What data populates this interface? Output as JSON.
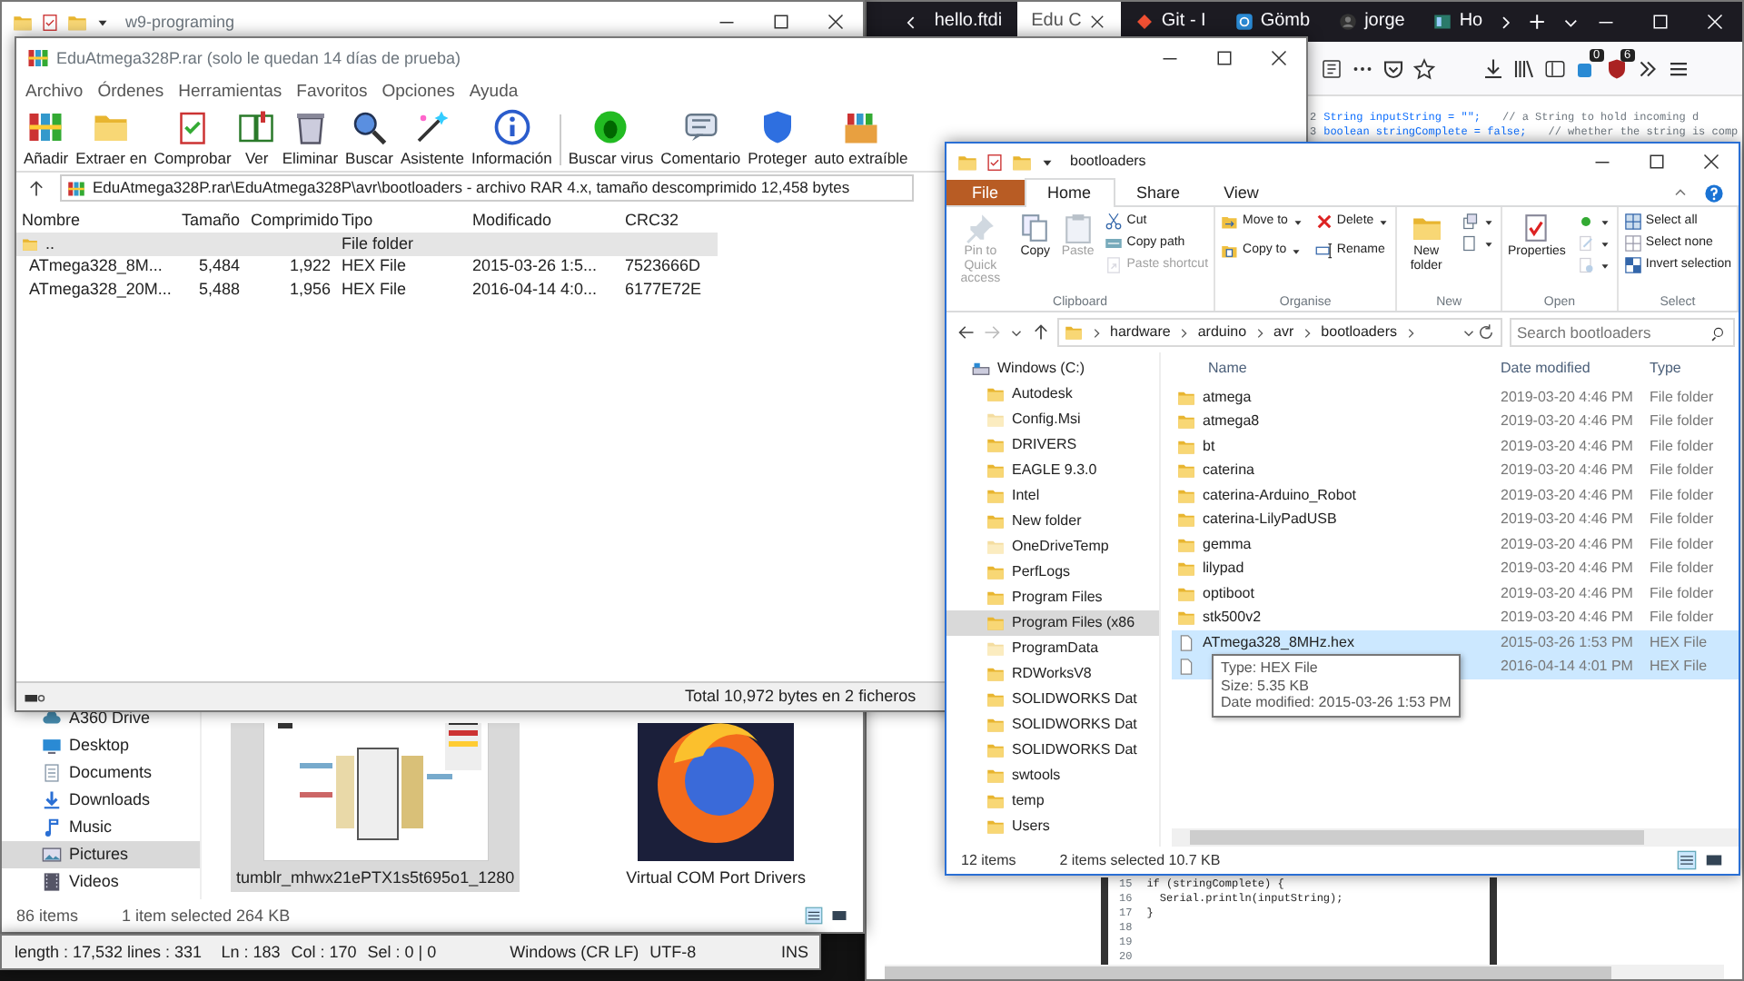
{
  "browser": {
    "tabs": [
      {
        "label": "hello.ftdi",
        "selected": false
      },
      {
        "label": "Edu C",
        "selected": true
      },
      {
        "label": "Git - I",
        "selected": false
      },
      {
        "label": "Gömb",
        "selected": false
      },
      {
        "label": "jorge",
        "selected": false
      },
      {
        "label": "Ho",
        "selected": false
      }
    ],
    "badges": [
      "0",
      "6"
    ],
    "code_top": [
      {
        "line": "2",
        "code": "String inputString = \"\";",
        "comment": "// a String to hold incoming d"
      },
      {
        "line": "3",
        "code": "boolean stringComplete = false;",
        "comment": "// whether the string is comp"
      }
    ],
    "code_bottom": [
      {
        "line": "15",
        "code": "if (stringComplete) {"
      },
      {
        "line": "16",
        "code": "  Serial.println(inputString);"
      },
      {
        "line": "17",
        "code": "}"
      },
      {
        "line": "18"
      },
      {
        "line": "19"
      },
      {
        "line": "20"
      }
    ]
  },
  "back_explorer": {
    "title": "w9-programing",
    "nav": [
      {
        "label": "A360 Drive",
        "selected": false
      },
      {
        "label": "Desktop",
        "selected": false
      },
      {
        "label": "Documents",
        "selected": false
      },
      {
        "label": "Downloads",
        "selected": false
      },
      {
        "label": "Music",
        "selected": false
      },
      {
        "label": "Pictures",
        "selected": true
      },
      {
        "label": "Videos",
        "selected": false
      }
    ],
    "thumbnails": [
      {
        "caption": "tumblr_mhwx21ePTX1s5t695o1_1280",
        "selected": true
      },
      {
        "caption": "Virtual COM Port Drivers",
        "selected": false
      }
    ],
    "status": {
      "count": "86 items",
      "selection": "1 item selected  264 KB"
    }
  },
  "editor_status": [
    "length : 17,532",
    "lines : 331",
    "Ln : 183",
    "Col : 170",
    "Sel : 0 | 0",
    "Windows (CR LF)",
    "UTF-8",
    "INS"
  ],
  "winrar": {
    "title": "EduAtmega328P.rar (solo le quedan 14 días de prueba)",
    "menu": [
      "Archivo",
      "Órdenes",
      "Herramientas",
      "Favoritos",
      "Opciones",
      "Ayuda"
    ],
    "toolbar": [
      "Añadir",
      "Extraer en",
      "Comprobar",
      "Ver",
      "Eliminar",
      "Buscar",
      "Asistente",
      "Información",
      "Buscar virus",
      "Comentario",
      "Proteger",
      "auto extraíble"
    ],
    "path": "EduAtmega328P.rar\\EduAtmega328P\\avr\\bootloaders - archivo RAR 4.x, tamaño descomprimido 12,458 bytes",
    "columns": [
      "Nombre",
      "Tamaño",
      "Comprimido",
      "Tipo",
      "Modificado",
      "CRC32"
    ],
    "rows": [
      {
        "kind": "folder",
        "name": "..",
        "type": "File folder",
        "selected": true
      },
      {
        "kind": "file",
        "name": "ATmega328_8M...",
        "size": "5,484",
        "packed": "1,922",
        "type": "HEX File",
        "modified": "2015-03-26 1:5...",
        "crc": "7523666D",
        "selected": false
      },
      {
        "kind": "file",
        "name": "ATmega328_20M...",
        "size": "5,488",
        "packed": "1,956",
        "type": "HEX File",
        "modified": "2016-04-14 4:0...",
        "crc": "6177E72E",
        "selected": false
      }
    ],
    "status": "Total 10,972 bytes en 2 ficheros"
  },
  "explorer": {
    "title": "bootloaders",
    "ribbon_tabs": [
      {
        "label": "File",
        "kind": "file",
        "selected": false
      },
      {
        "label": "Home",
        "kind": "tab",
        "selected": true
      },
      {
        "label": "Share",
        "kind": "tab",
        "selected": false
      },
      {
        "label": "View",
        "kind": "tab",
        "selected": false
      }
    ],
    "groups": [
      {
        "label": "Clipboard",
        "commands": [
          {
            "label": "Pin to Quick access",
            "kind": "large",
            "disabled": true
          },
          {
            "label": "Copy",
            "kind": "large",
            "disabled": false
          },
          {
            "label": "Paste",
            "kind": "large",
            "disabled": true
          },
          {
            "label": "Cut",
            "kind": "small",
            "disabled": false
          },
          {
            "label": "Copy path",
            "kind": "small",
            "disabled": false
          },
          {
            "label": "Paste shortcut",
            "kind": "small",
            "disabled": true
          }
        ]
      },
      {
        "label": "Organise",
        "commands": [
          {
            "label": "Move to",
            "kind": "split",
            "disabled": false
          },
          {
            "label": "Delete",
            "kind": "split",
            "disabled": false
          },
          {
            "label": "Copy to",
            "kind": "split",
            "disabled": false
          },
          {
            "label": "Rename",
            "kind": "small",
            "disabled": false
          }
        ]
      },
      {
        "label": "New",
        "commands": [
          {
            "label": "New folder",
            "kind": "large",
            "disabled": false
          },
          {
            "kind": "icon",
            "disabled": false
          },
          {
            "kind": "icon",
            "disabled": false
          }
        ]
      },
      {
        "label": "Open",
        "commands": [
          {
            "label": "Properties",
            "kind": "large",
            "disabled": false
          },
          {
            "kind": "icon",
            "disabled": false
          },
          {
            "kind": "icon",
            "disabled": true
          },
          {
            "kind": "icon",
            "disabled": true
          }
        ]
      },
      {
        "label": "Select",
        "commands": [
          {
            "label": "Select all",
            "kind": "small",
            "disabled": false
          },
          {
            "label": "Select none",
            "kind": "small",
            "disabled": false
          },
          {
            "label": "Invert selection",
            "kind": "small",
            "disabled": false
          }
        ]
      }
    ],
    "breadcrumbs": [
      "hardware",
      "arduino",
      "avr",
      "bootloaders"
    ],
    "search": {
      "placeholder": "Search bootloaders"
    },
    "nav": [
      {
        "label": "Windows (C:)",
        "selected": false,
        "hidden": false,
        "children": [
          {
            "label": "Autodesk",
            "selected": false,
            "hidden": false
          },
          {
            "label": "Config.Msi",
            "selected": false,
            "hidden": true
          },
          {
            "label": "DRIVERS",
            "selected": false,
            "hidden": false
          },
          {
            "label": "EAGLE 9.3.0",
            "selected": false,
            "hidden": false
          },
          {
            "label": "Intel",
            "selected": false,
            "hidden": false
          },
          {
            "label": "New folder",
            "selected": false,
            "hidden": false
          },
          {
            "label": "OneDriveTemp",
            "selected": false,
            "hidden": true
          },
          {
            "label": "PerfLogs",
            "selected": false,
            "hidden": false
          },
          {
            "label": "Program Files",
            "selected": false,
            "hidden": false
          },
          {
            "label": "Program Files (x86",
            "selected": true,
            "hidden": false
          },
          {
            "label": "ProgramData",
            "selected": false,
            "hidden": true
          },
          {
            "label": "RDWorksV8",
            "selected": false,
            "hidden": false
          },
          {
            "label": "SOLIDWORKS Dat",
            "selected": false,
            "hidden": false
          },
          {
            "label": "SOLIDWORKS Dat",
            "selected": false,
            "hidden": false
          },
          {
            "label": "SOLIDWORKS Dat",
            "selected": false,
            "hidden": false
          },
          {
            "label": "swtools",
            "selected": false,
            "hidden": false
          },
          {
            "label": "temp",
            "selected": false,
            "hidden": false
          },
          {
            "label": "Users",
            "selected": false,
            "hidden": false
          }
        ]
      }
    ],
    "columns": [
      "Name",
      "Date modified",
      "Type"
    ],
    "files": [
      {
        "kind": "folder",
        "name": "atmega",
        "date": "2019-03-20 4:46 PM",
        "type": "File folder",
        "selected": false
      },
      {
        "kind": "folder",
        "name": "atmega8",
        "date": "2019-03-20 4:46 PM",
        "type": "File folder",
        "selected": false
      },
      {
        "kind": "folder",
        "name": "bt",
        "date": "2019-03-20 4:46 PM",
        "type": "File folder",
        "selected": false
      },
      {
        "kind": "folder",
        "name": "caterina",
        "date": "2019-03-20 4:46 PM",
        "type": "File folder",
        "selected": false
      },
      {
        "kind": "folder",
        "name": "caterina-Arduino_Robot",
        "date": "2019-03-20 4:46 PM",
        "type": "File folder",
        "selected": false
      },
      {
        "kind": "folder",
        "name": "caterina-LilyPadUSB",
        "date": "2019-03-20 4:46 PM",
        "type": "File folder",
        "selected": false
      },
      {
        "kind": "folder",
        "name": "gemma",
        "date": "2019-03-20 4:46 PM",
        "type": "File folder",
        "selected": false
      },
      {
        "kind": "folder",
        "name": "lilypad",
        "date": "2019-03-20 4:46 PM",
        "type": "File folder",
        "selected": false
      },
      {
        "kind": "folder",
        "name": "optiboot",
        "date": "2019-03-20 4:46 PM",
        "type": "File folder",
        "selected": false
      },
      {
        "kind": "folder",
        "name": "stk500v2",
        "date": "2019-03-20 4:46 PM",
        "type": "File folder",
        "selected": false
      },
      {
        "kind": "file",
        "name": "ATmega328_8MHz.hex",
        "date": "2015-03-26 1:53 PM",
        "type": "HEX File",
        "selected": true
      },
      {
        "kind": "file",
        "date": "2016-04-14 4:01 PM",
        "type": "HEX File",
        "selected": true
      }
    ],
    "tooltip": [
      "Type: HEX File",
      "Size: 5.35 KB",
      "Date modified: 2015-03-26 1:53 PM"
    ],
    "status": {
      "count": "12 items",
      "selection": "2 items selected  10.7 KB"
    }
  }
}
